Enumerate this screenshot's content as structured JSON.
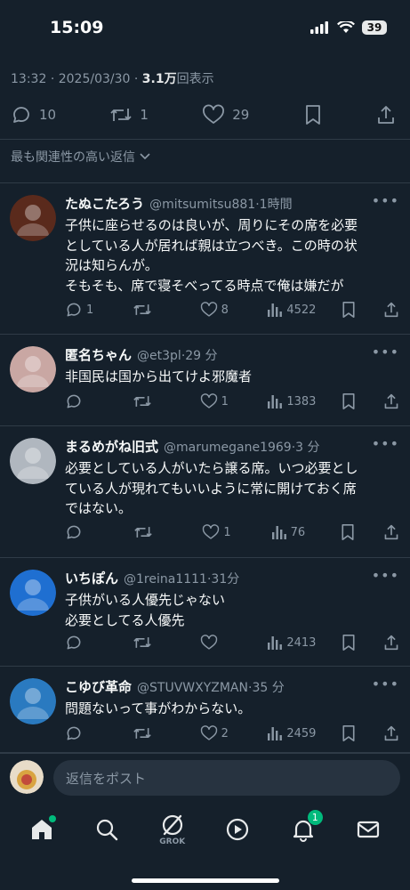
{
  "status_bar": {
    "time": "15:09",
    "battery": "39"
  },
  "tweet": {
    "time": "13:32",
    "date": "2025/03/30",
    "views_value": "3.1万",
    "views_label": "回表示",
    "replies": "10",
    "retweets": "1",
    "likes": "29"
  },
  "sort_label": "最も関連性の高い返信",
  "replies": [
    {
      "name": "たぬこたろう",
      "handle": "@mitsumitsu881",
      "age": "1時間",
      "text": "子供に座らせるのは良いが、周りにその席を必要\nとしている人が居れば親は立つべき。この時の状\n況は知らんが。\nそもそも、席で寝そべってる時点で俺は嫌だが",
      "replies": "1",
      "retweets": "",
      "likes": "8",
      "views": "4522",
      "avatar_color": "#5a2a1c"
    },
    {
      "name": "匿名ちゃん",
      "handle": "@et3pl",
      "age": "29 分",
      "text": "非国民は国から出てけよ邪魔者",
      "replies": "",
      "retweets": "",
      "likes": "1",
      "views": "1383",
      "avatar_color": "#c9a7a3"
    },
    {
      "name": "まるめがね旧式",
      "handle": "@marumegane1969",
      "age": "3 分",
      "text": "必要としている人がいたら譲る席。いつ必要とし\nている人が現れてもいいように常に開けておく席\nではない。",
      "replies": "",
      "retweets": "",
      "likes": "1",
      "views": "76",
      "avatar_color": "#b0b7bf"
    },
    {
      "name": "いちぽん",
      "handle": "@1reina1111",
      "age": "31分",
      "text": "子供がいる人優先じゃない\n必要としてる人優先",
      "replies": "",
      "retweets": "",
      "likes": "",
      "views": "2413",
      "avatar_color": "#1f6fd1"
    },
    {
      "name": "こゆび革命",
      "handle": "@STUVWXYZMAN",
      "age": "35 分",
      "text": "問題ないって事がわからない。",
      "replies": "",
      "retweets": "",
      "likes": "2",
      "views": "2459",
      "avatar_color": "#2a7ac0"
    }
  ],
  "composer": {
    "placeholder": "返信をポスト"
  },
  "tabbar": {
    "grok_label": "GROK",
    "notification_count": "1"
  },
  "colors": {
    "background": "#15202b",
    "secondary_text": "#8b98a5",
    "badge": "#00ba7c"
  }
}
